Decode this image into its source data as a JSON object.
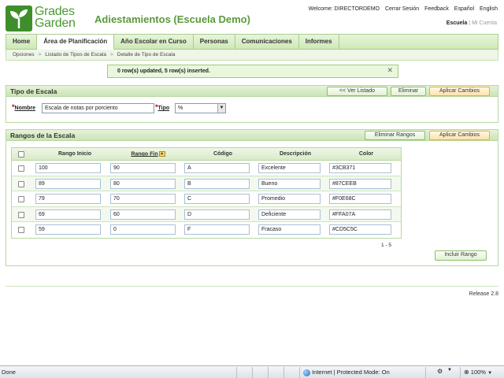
{
  "header": {
    "logo_line1": "Grades",
    "logo_line2": "Garden",
    "title": "Adiestamientos (Escuela Demo)",
    "welcome": "Welcome: DIRECTORDEMO",
    "logout": "Cerrar Sesión",
    "feedback": "Feedback",
    "lang_es": "Español",
    "lang_en": "English",
    "account_school": "Escuela",
    "account_mine": "Mi Cuenta"
  },
  "nav": {
    "items": [
      "Home",
      "Área de Planificación",
      "Año Escolar en Curso",
      "Personas",
      "Comunicaciones",
      "Informes"
    ],
    "active_index": 1
  },
  "breadcrumb": [
    "Opciones",
    "Listado de Tipos de Escala",
    "Detalle de Tipo de Escala"
  ],
  "message": {
    "text": "0 row(s) updated, 5 row(s) inserted.",
    "close": "✕"
  },
  "scale_type": {
    "title": "Tipo de Escala",
    "btn_back": "<< Ver Listado",
    "btn_delete": "Eliminar",
    "btn_apply": "Aplicar Cambios",
    "name_label": "Nombre",
    "name_value": "Escala de notas por porciento",
    "type_label": "Tipo",
    "type_value": "%"
  },
  "ranges": {
    "title": "Rangos de la Escala",
    "btn_delete": "Eliminar Rangos",
    "btn_apply": "Aplicar Cambios",
    "columns": [
      "Rango Inicio",
      "Rango Fin",
      "Código",
      "Descripción",
      "Color"
    ],
    "rows": [
      {
        "start": "100",
        "end": "90",
        "code": "A",
        "desc": "Excelente",
        "color": "#3CB371"
      },
      {
        "start": "89",
        "end": "80",
        "code": "B",
        "desc": "Bueno",
        "color": "#87CEEB"
      },
      {
        "start": "79",
        "end": "70",
        "code": "C",
        "desc": "Promedio",
        "color": "#F0E68C"
      },
      {
        "start": "69",
        "end": "60",
        "code": "D",
        "desc": "Deficiente",
        "color": "#FFA07A"
      },
      {
        "start": "59",
        "end": "0",
        "code": "F",
        "desc": "Fracaso",
        "color": "#CD5C5C"
      }
    ],
    "pager": "1 - 5",
    "btn_add": "Incluir Rango"
  },
  "release": "Release 2.8",
  "statusbar": {
    "left": "Done",
    "zone": "Internet | Protected Mode: On",
    "zoom": "100%"
  },
  "colors": {
    "brand_green": "#4a9a30",
    "accent_orange": "#ffe2a8"
  }
}
